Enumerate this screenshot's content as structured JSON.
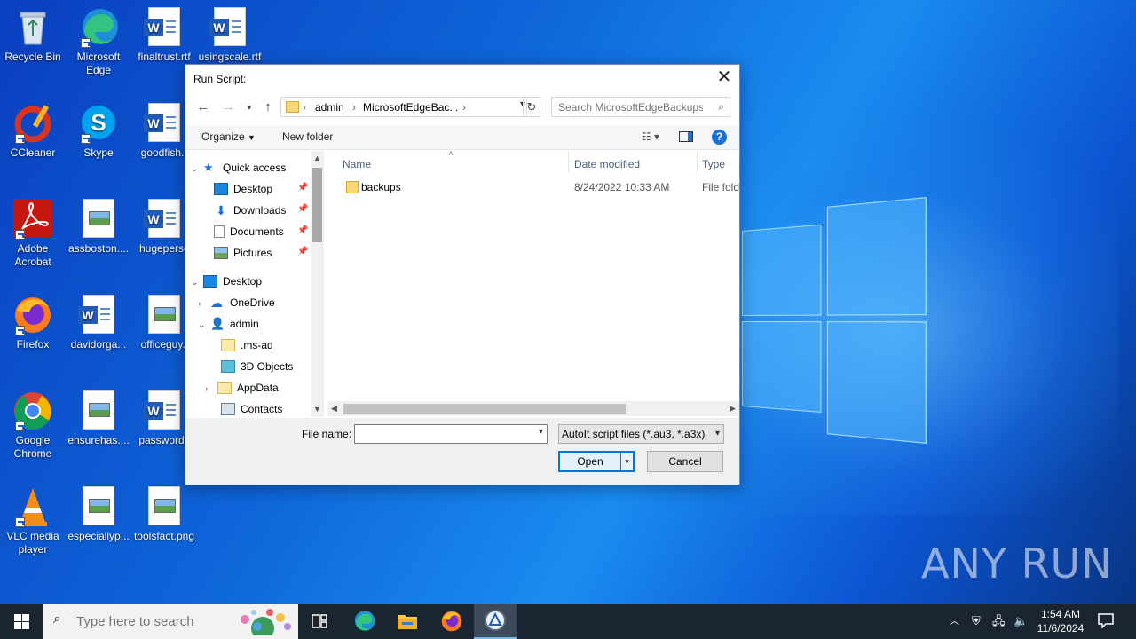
{
  "desktop": {
    "icons": [
      {
        "label": "Recycle Bin"
      },
      {
        "label": "Microsoft Edge"
      },
      {
        "label": "finaltrust.rtf"
      },
      {
        "label": "usingscale.rtf"
      },
      {
        "label": "CCleaner"
      },
      {
        "label": "Skype"
      },
      {
        "label": "goodfish.r"
      },
      {
        "label": "Adobe Acrobat"
      },
      {
        "label": "assboston...."
      },
      {
        "label": "hugepersc"
      },
      {
        "label": "Firefox"
      },
      {
        "label": "davidorga..."
      },
      {
        "label": "officeguy.j"
      },
      {
        "label": "Google Chrome"
      },
      {
        "label": "ensurehas...."
      },
      {
        "label": "passwordc"
      },
      {
        "label": "VLC media player"
      },
      {
        "label": "especiallyp..."
      },
      {
        "label": "toolsfact.png"
      }
    ],
    "watermark": "ANY RUN"
  },
  "dialog": {
    "title": "Run Script:",
    "breadcrumb": [
      "admin",
      "MicrosoftEdgeBac..."
    ],
    "search_placeholder": "Search MicrosoftEdgeBackups",
    "toolbar": {
      "organize": "Organize",
      "new_folder": "New folder"
    },
    "nav_tree": [
      {
        "label": "Quick access"
      },
      {
        "label": "Desktop"
      },
      {
        "label": "Downloads"
      },
      {
        "label": "Documents"
      },
      {
        "label": "Pictures"
      },
      {
        "label": "Desktop"
      },
      {
        "label": "OneDrive"
      },
      {
        "label": "admin"
      },
      {
        "label": ".ms-ad"
      },
      {
        "label": "3D Objects"
      },
      {
        "label": "AppData"
      },
      {
        "label": "Contacts"
      }
    ],
    "columns": {
      "name": "Name",
      "date_modified": "Date modified",
      "type": "Type"
    },
    "files": [
      {
        "name": "backups",
        "date_modified": "8/24/2022 10:33 AM",
        "type": "File fold"
      }
    ],
    "file_name_label": "File name:",
    "file_name_value": "",
    "file_type_filter": "AutoIt script files (*.au3, *.a3x)",
    "open_label": "Open",
    "cancel_label": "Cancel"
  },
  "taskbar": {
    "search_placeholder": "Type here to search",
    "time": "1:54 AM",
    "date": "11/6/2024"
  },
  "colors": {
    "accent": "#0078d7",
    "taskbar": "#1b2531",
    "folder": "#f8d775"
  }
}
